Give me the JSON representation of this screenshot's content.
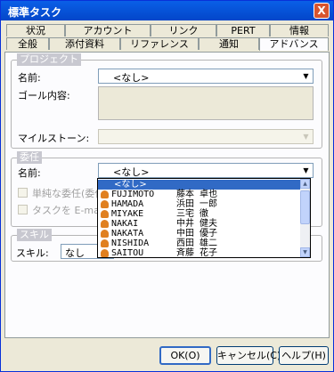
{
  "window": {
    "title": "標準タスク",
    "close_label": "X"
  },
  "tabs_back": [
    "状況",
    "アカウント",
    "リンク",
    "PERT",
    "情報"
  ],
  "tabs_front": [
    "全般",
    "添付資料",
    "リファレンス",
    "通知",
    "アドバンス"
  ],
  "project": {
    "legend": "プロジェクト",
    "name_label": "名前:",
    "name_value": "<なし>",
    "goal_label": "ゴール内容:",
    "milestone_label": "マイルストーン:"
  },
  "delegation": {
    "legend": "委任",
    "name_label": "名前:",
    "name_value": "<なし>",
    "simple_delegation_label": "単純な委任(委任",
    "email_task_label": "タスクを E-mail 経"
  },
  "skill": {
    "legend": "スキル",
    "skill_label": "スキル:",
    "skill_value": "なし"
  },
  "dropdown": {
    "none_label": "<なし>",
    "users": [
      {
        "romaji": "FUJIMOTO",
        "kanji": "藤本 卓也"
      },
      {
        "romaji": "HAMADA",
        "kanji": "浜田 一郎"
      },
      {
        "romaji": "MIYAKE",
        "kanji": "三宅 徹"
      },
      {
        "romaji": "NAKAI",
        "kanji": "中井 健夫"
      },
      {
        "romaji": "NAKATA",
        "kanji": "中田 優子"
      },
      {
        "romaji": "NISHIDA",
        "kanji": "西田 雄二"
      },
      {
        "romaji": "SAITOU",
        "kanji": "斉藤 花子"
      }
    ]
  },
  "buttons": {
    "ok": "OK(O)",
    "cancel": "キャンセル(C)",
    "help": "ヘルプ(H)"
  }
}
